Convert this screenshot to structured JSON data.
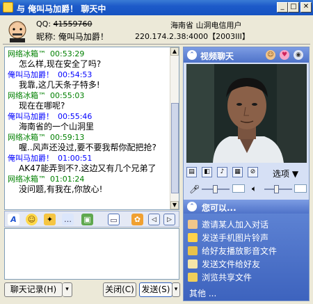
{
  "window": {
    "title": "与  俺叫马加爵！  聊天中"
  },
  "header": {
    "qq_label": "QQ:",
    "qq_number": "41559760",
    "nickname_label": "昵称:",
    "nickname": "俺叫马加爵！",
    "location": "海南省  山洞电信用户",
    "ip_info": "220.174.2.38:4000【2003III】"
  },
  "messages": [
    {
      "sender": "网络冰箱™",
      "time": "00:53:29",
      "text": "怎么样,现在安全了吗?",
      "color": "#008000"
    },
    {
      "sender": "俺叫马加爵！",
      "time": "00:54:53",
      "text": "我靠,这几天条子特多!",
      "color": "#0000ff"
    },
    {
      "sender": "网络冰箱™",
      "time": "00:55:03",
      "text": "现在在哪呢?",
      "color": "#008000"
    },
    {
      "sender": "俺叫马加爵！",
      "time": "00:55:46",
      "text": "海南省的一个山洞里",
      "color": "#0000ff"
    },
    {
      "sender": "网络冰箱™",
      "time": "00:59:13",
      "text": "喔..风声还没过,要不要我帮你配把抢?",
      "color": "#008000"
    },
    {
      "sender": "俺叫马加爵！",
      "time": "01:00:51",
      "text": "AK47能弄到不?.这边又有几个兄弟了",
      "color": "#0000ff"
    },
    {
      "sender": "网络冰箱™",
      "time": "01:01:24",
      "text": "没问题,有我在,你放心!",
      "color": "#008000"
    }
  ],
  "buttons": {
    "history": "聊天记录(H)",
    "close": "关闭(C)",
    "send": "发送(S)"
  },
  "video_panel": {
    "title": "视频聊天",
    "options_label": "选项"
  },
  "actions_panel": {
    "title": "您可以...",
    "items": [
      {
        "label": "邀请某人加入对话",
        "icon": "invite-icon"
      },
      {
        "label": "发送手机图片铃声",
        "icon": "mobile-icon"
      },
      {
        "label": "给好友播放影音文件",
        "icon": "media-icon"
      },
      {
        "label": "发送文件给好友",
        "icon": "file-icon"
      },
      {
        "label": "浏览共享文件",
        "icon": "folder-icon"
      }
    ],
    "other": "其他 ..."
  }
}
